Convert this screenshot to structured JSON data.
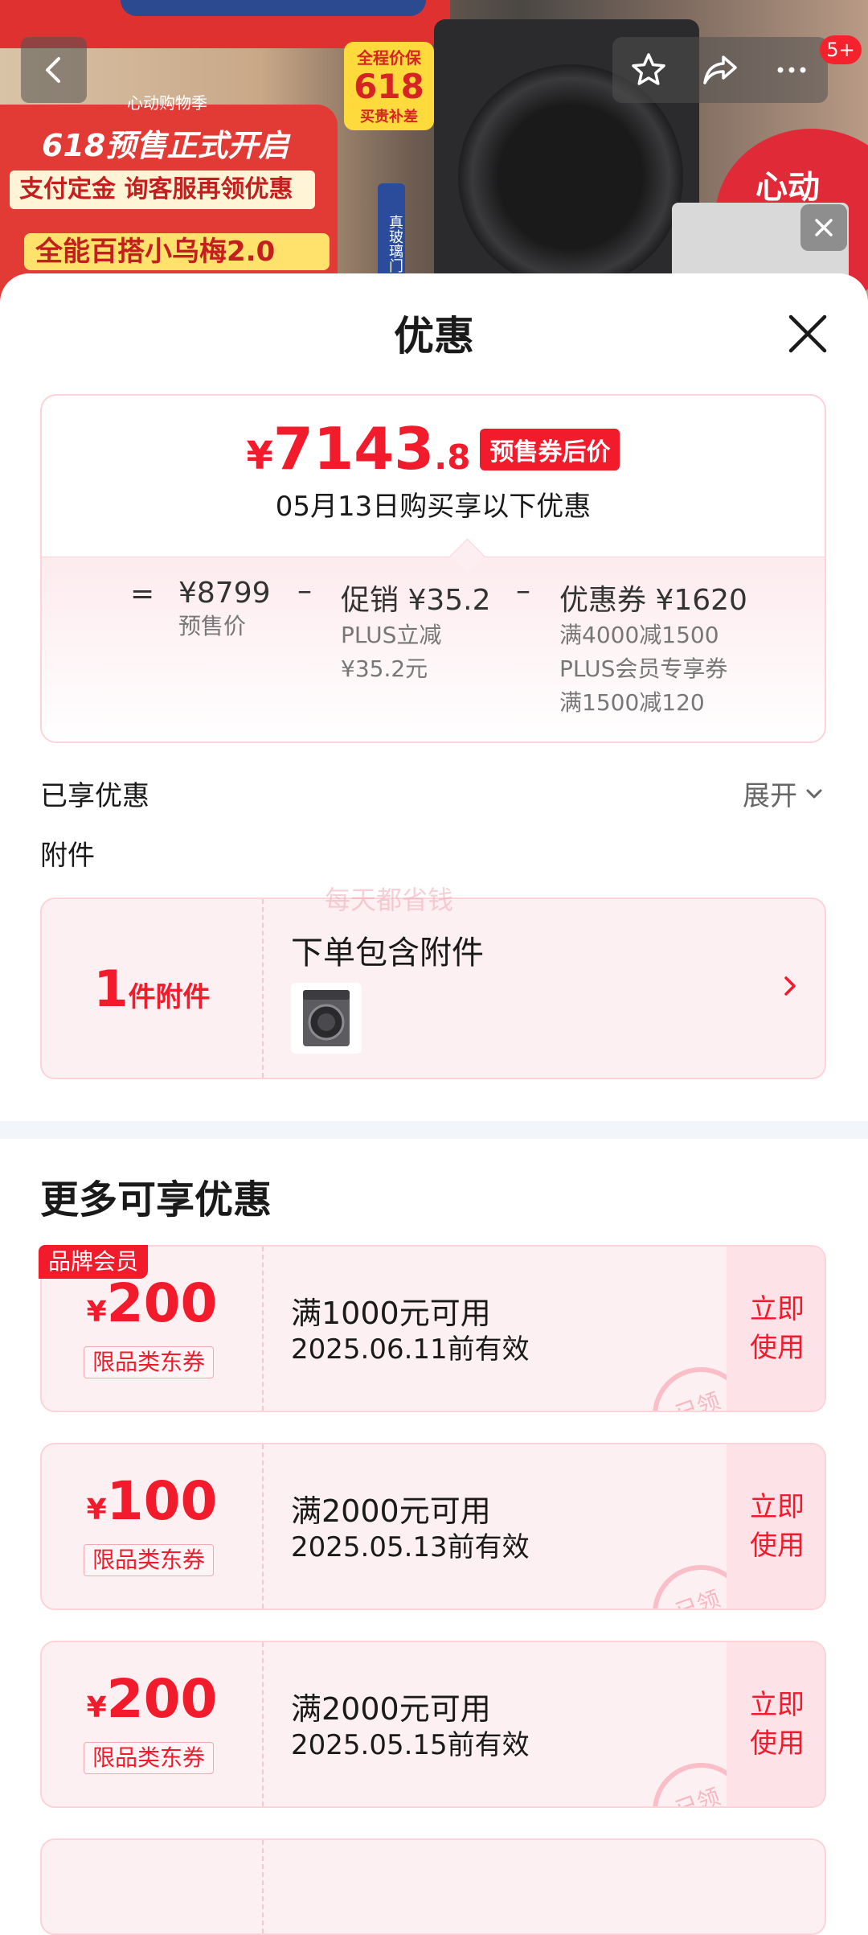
{
  "background": {
    "sign_brand": "心动购物季",
    "sign_title": "618预售正式开启",
    "sign_line2": "支付定金 询客服再领优惠",
    "sign_line3": "全能百搭小乌梅2.0",
    "badge_top": "全程价保",
    "badge_mid": "618",
    "badge_bottom": "买贵补差",
    "vertical_text": "真玻璃门",
    "right_text": "心动"
  },
  "topbar": {
    "message_badge": "5+"
  },
  "sheet": {
    "title": "优惠"
  },
  "price_card": {
    "currency": "¥",
    "final_int": "7143",
    "final_dec": ".8",
    "final_tag": "预售券后价",
    "subtitle": "05月13日购买享以下优惠",
    "eq": "=",
    "minus": "–",
    "presale_price": "¥8799",
    "presale_label": "预售价",
    "promo_label": "促销 ¥35.2",
    "promo_line1": "PLUS立减",
    "promo_line2": "¥35.2元",
    "coupon_label": "优惠券 ¥1620",
    "coupon_line1": "满4000减1500",
    "coupon_line2": "PLUS会员专享券",
    "coupon_line3": "满1500减120"
  },
  "enjoyed": {
    "label": "已享优惠",
    "expand_label": "展开"
  },
  "attachment": {
    "section_label": "附件",
    "count": "1",
    "count_unit": "件附件",
    "title": "下单包含附件",
    "watermark": "每天都省钱"
  },
  "more": {
    "title": "更多可享优惠",
    "brand_tag": "品牌会员",
    "use_line1": "立即",
    "use_line2": "使用",
    "stamp": "已领",
    "coupons": [
      {
        "currency": "¥",
        "amount": "200",
        "type": "限品类东券",
        "condition": "满1000元可用",
        "valid": "2025.06.11前有效"
      },
      {
        "currency": "¥",
        "amount": "100",
        "type": "限品类东券",
        "condition": "满2000元可用",
        "valid": "2025.05.13前有效"
      },
      {
        "currency": "¥",
        "amount": "200",
        "type": "限品类东券",
        "condition": "满2000元可用",
        "valid": "2025.05.15前有效"
      }
    ]
  },
  "colors": {
    "accent": "#f21b2c",
    "card_border": "#fbd3d8",
    "card_bg": "#fdf0f2"
  }
}
